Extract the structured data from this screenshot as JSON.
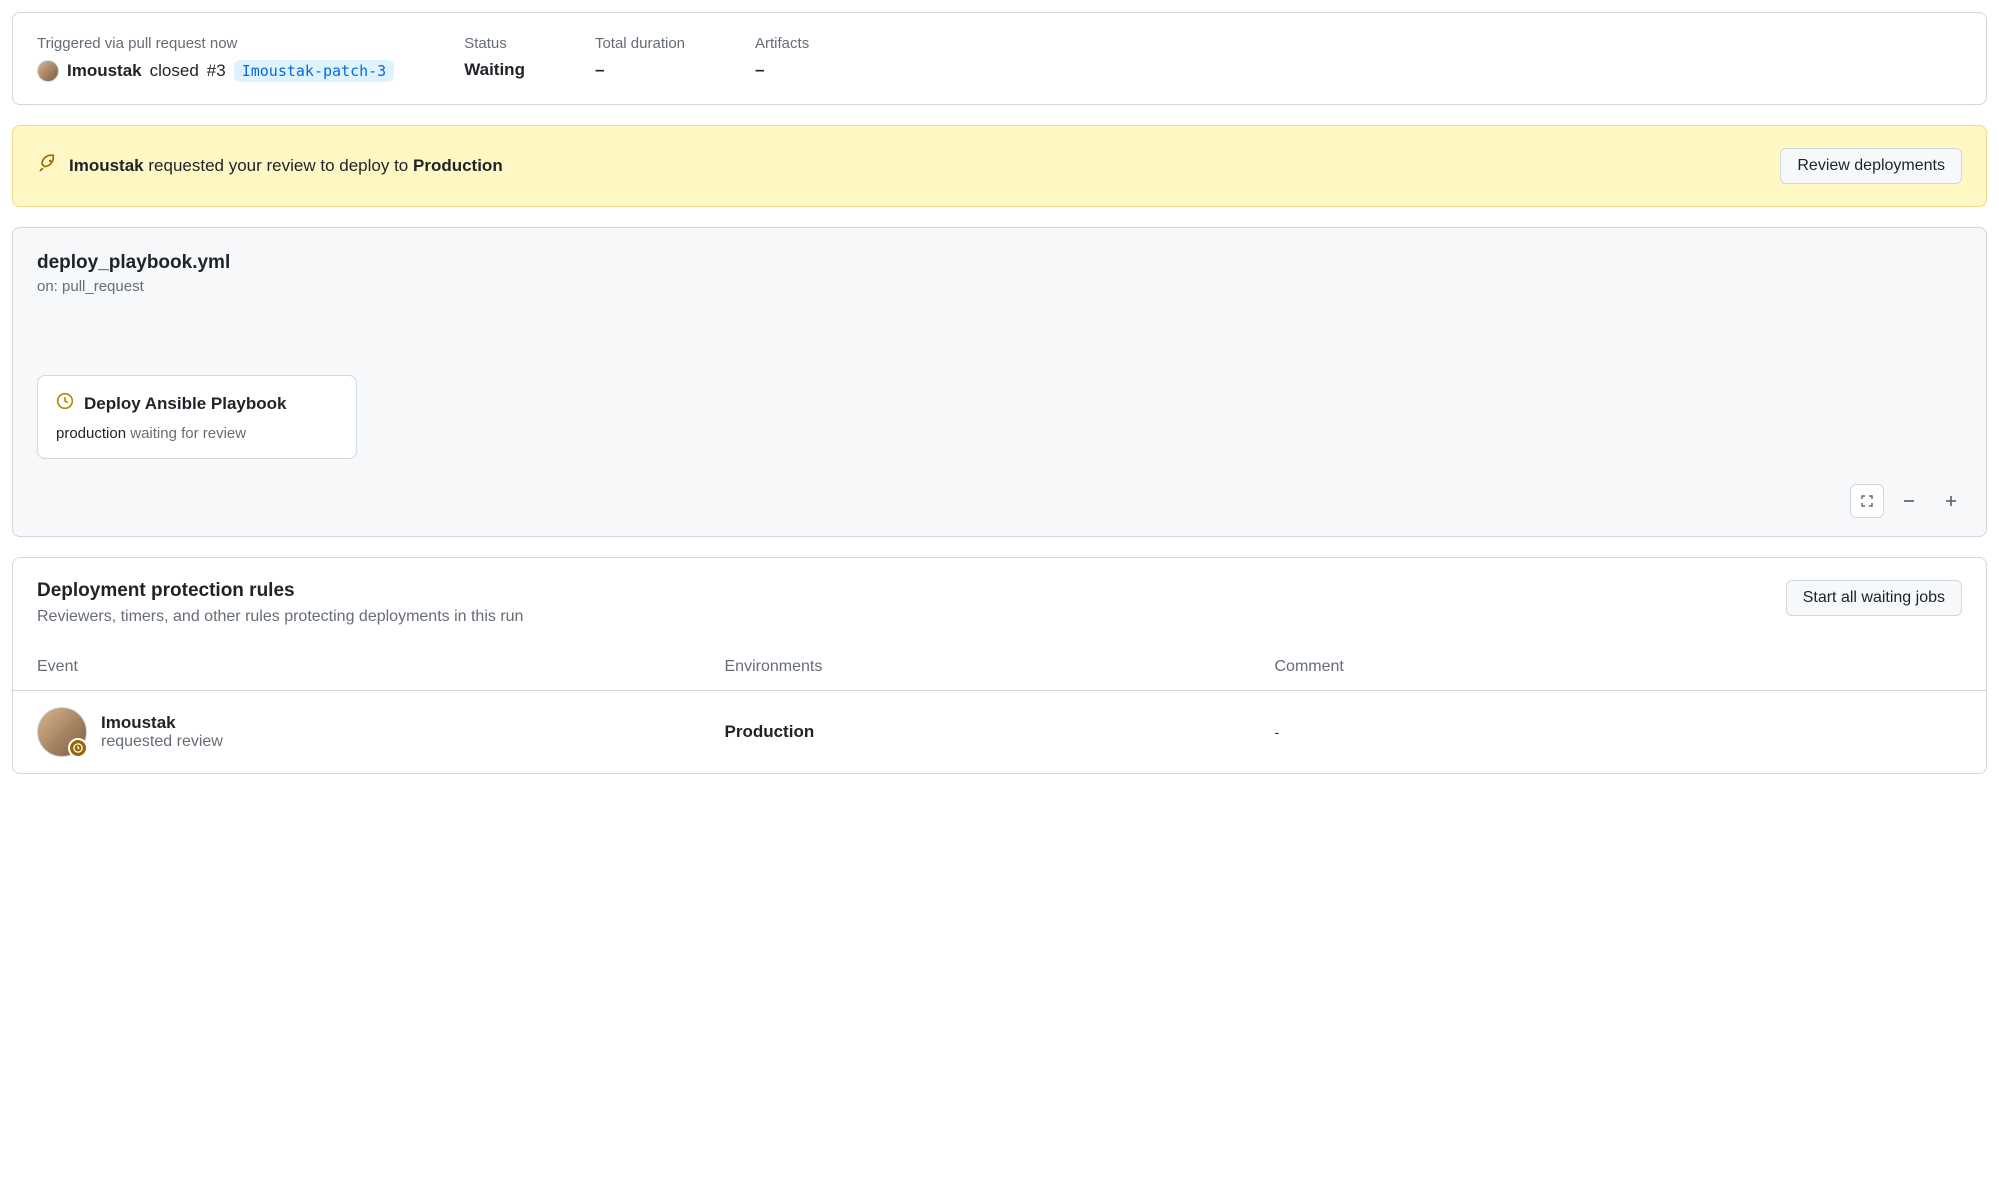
{
  "summary": {
    "triggered_label": "Triggered via pull request now",
    "actor": "Imoustak",
    "action_text": "closed",
    "pr_number": "#3",
    "branch": "Imoustak-patch-3",
    "status_label": "Status",
    "status_value": "Waiting",
    "duration_label": "Total duration",
    "duration_value": "–",
    "artifacts_label": "Artifacts",
    "artifacts_value": "–"
  },
  "banner": {
    "actor": "Imoustak",
    "middle_text": "requested your review to deploy to",
    "target": "Production",
    "button_label": "Review deployments"
  },
  "workflow": {
    "file": "deploy_playbook.yml",
    "on_prefix": "on:",
    "on_event": "pull_request",
    "job": {
      "name": "Deploy Ansible Playbook",
      "environment": "production",
      "status_text": "waiting for review"
    }
  },
  "rules": {
    "title": "Deployment protection rules",
    "subtitle": "Reviewers, timers, and other rules protecting deployments in this run",
    "start_button": "Start all waiting jobs",
    "headers": {
      "event": "Event",
      "environments": "Environments",
      "comment": "Comment"
    },
    "rows": [
      {
        "actor": "Imoustak",
        "sub": "requested review",
        "environment": "Production",
        "comment": "-"
      }
    ]
  }
}
